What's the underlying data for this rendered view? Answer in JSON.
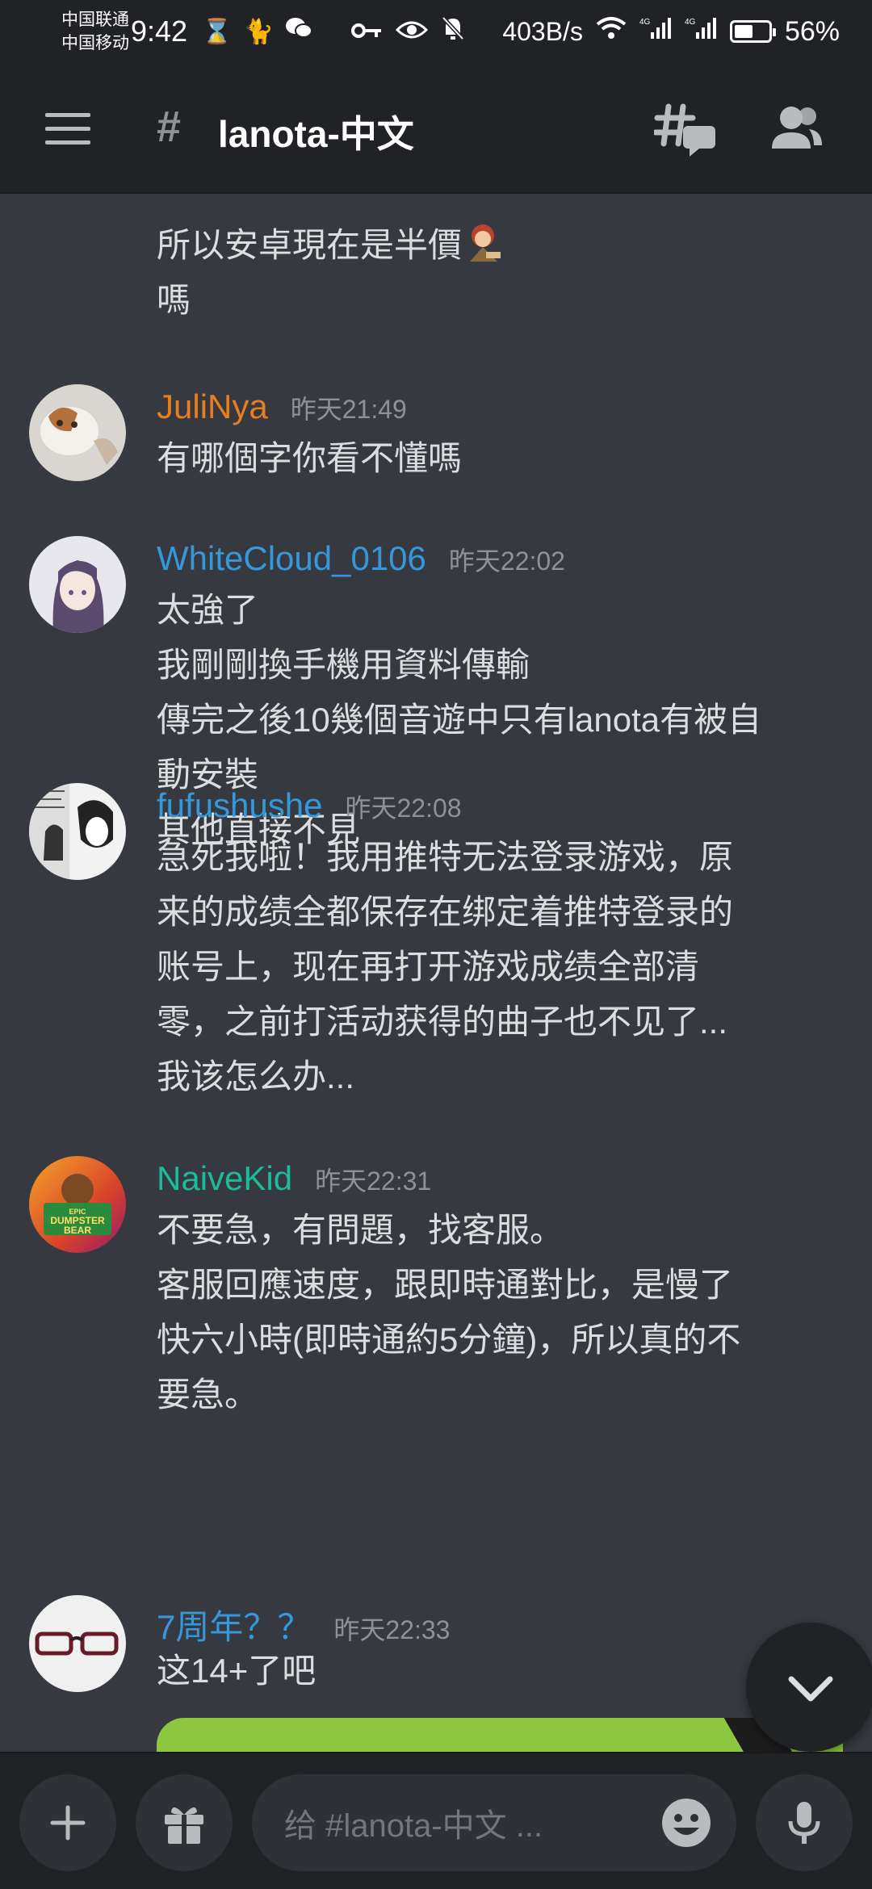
{
  "status_bar": {
    "carrier_1": "中国联通",
    "carrier_2": "中国移动",
    "time": "9:42",
    "net_speed": "403B/s",
    "battery": "56%",
    "battery_level": 0.56
  },
  "header": {
    "channel_name": "lanota-中文"
  },
  "messages": [
    {
      "username": "",
      "timestamp": "",
      "lines": [
        "所以安卓現在是半價",
        "嗎"
      ]
    },
    {
      "username": "JuliNya",
      "username_color": "#e67e22",
      "timestamp": "昨天21:49",
      "lines": [
        "有哪個字你看不懂嗎"
      ]
    },
    {
      "username": "WhiteCloud_0106",
      "username_color": "#3498db",
      "timestamp": "昨天22:02",
      "lines": [
        "太強了",
        "我剛剛換手機用資料傳輸",
        "傳完之後10幾個音遊中只有lanota有被自",
        "動安裝",
        "其他直接不見"
      ]
    },
    {
      "username": "fufushushe",
      "username_color": "#3498db",
      "timestamp": "昨天22:08",
      "lines": [
        "急死我啦！我用推特无法登录游戏，原",
        "来的成绩全都保存在绑定着推特登录的",
        "账号上，现在再打开游戏成绩全部清",
        "零，之前打活动获得的曲子也不见了...",
        "我该怎么办..."
      ]
    },
    {
      "username": "NaiveKid",
      "username_color": "#1abc9c",
      "timestamp": "昨天22:31",
      "lines": [
        "不要急，有問題，找客服。",
        "客服回應速度，跟即時通對比，是慢了",
        "快六小時(即時通約5分鐘)，所以真的不",
        "要急。"
      ]
    },
    {
      "username": "7周年？？",
      "username_color": "#3498db",
      "timestamp": "昨天22:33",
      "lines": [
        "这14+了吧"
      ]
    }
  ],
  "avatar_text": {
    "naivekid": "EPIC DUMPSTER BEAR"
  },
  "composer": {
    "placeholder": "给 #lanota-中文 ..."
  },
  "colors": {
    "background": "#36393f",
    "header": "#202225",
    "text": "#dcddde",
    "muted": "#8e9297"
  }
}
